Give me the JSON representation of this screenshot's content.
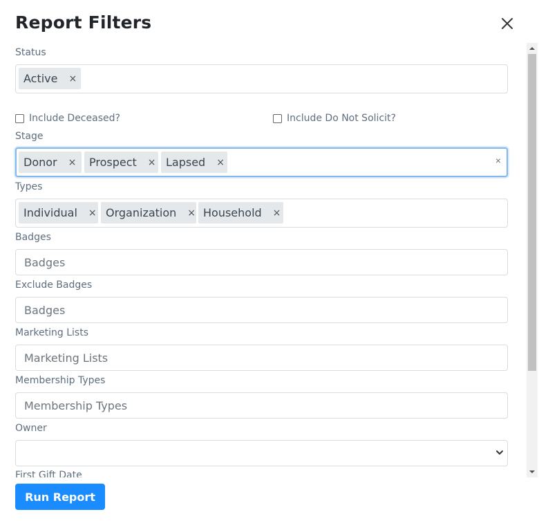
{
  "modal": {
    "title": "Report Filters"
  },
  "status": {
    "label": "Status",
    "tags": [
      "Active"
    ]
  },
  "checkboxes": {
    "include_deceased": "Include Deceased?",
    "include_do_not_solicit": "Include Do Not Solicit?"
  },
  "stage": {
    "label": "Stage",
    "tags": [
      "Donor",
      "Prospect",
      "Lapsed"
    ]
  },
  "types": {
    "label": "Types",
    "tags": [
      "Individual",
      "Organization",
      "Household"
    ]
  },
  "badges": {
    "label": "Badges",
    "placeholder": "Badges"
  },
  "exclude_badges": {
    "label": "Exclude Badges",
    "placeholder": "Badges"
  },
  "marketing_lists": {
    "label": "Marketing Lists",
    "placeholder": "Marketing Lists"
  },
  "membership_types": {
    "label": "Membership Types",
    "placeholder": "Membership Types"
  },
  "owner": {
    "label": "Owner",
    "value": ""
  },
  "first_gift_date": {
    "label": "First Gift Date"
  },
  "footer": {
    "run_label": "Run Report"
  },
  "icons": {
    "close": "close-icon",
    "tag_remove": "×",
    "clear_all": "×",
    "select": "chevron-down-icon"
  },
  "colors": {
    "primary": "#1a8cff",
    "tag_bg": "#e5e8eb",
    "focus_border": "#80b8ee",
    "label": "#5e6e7e"
  }
}
